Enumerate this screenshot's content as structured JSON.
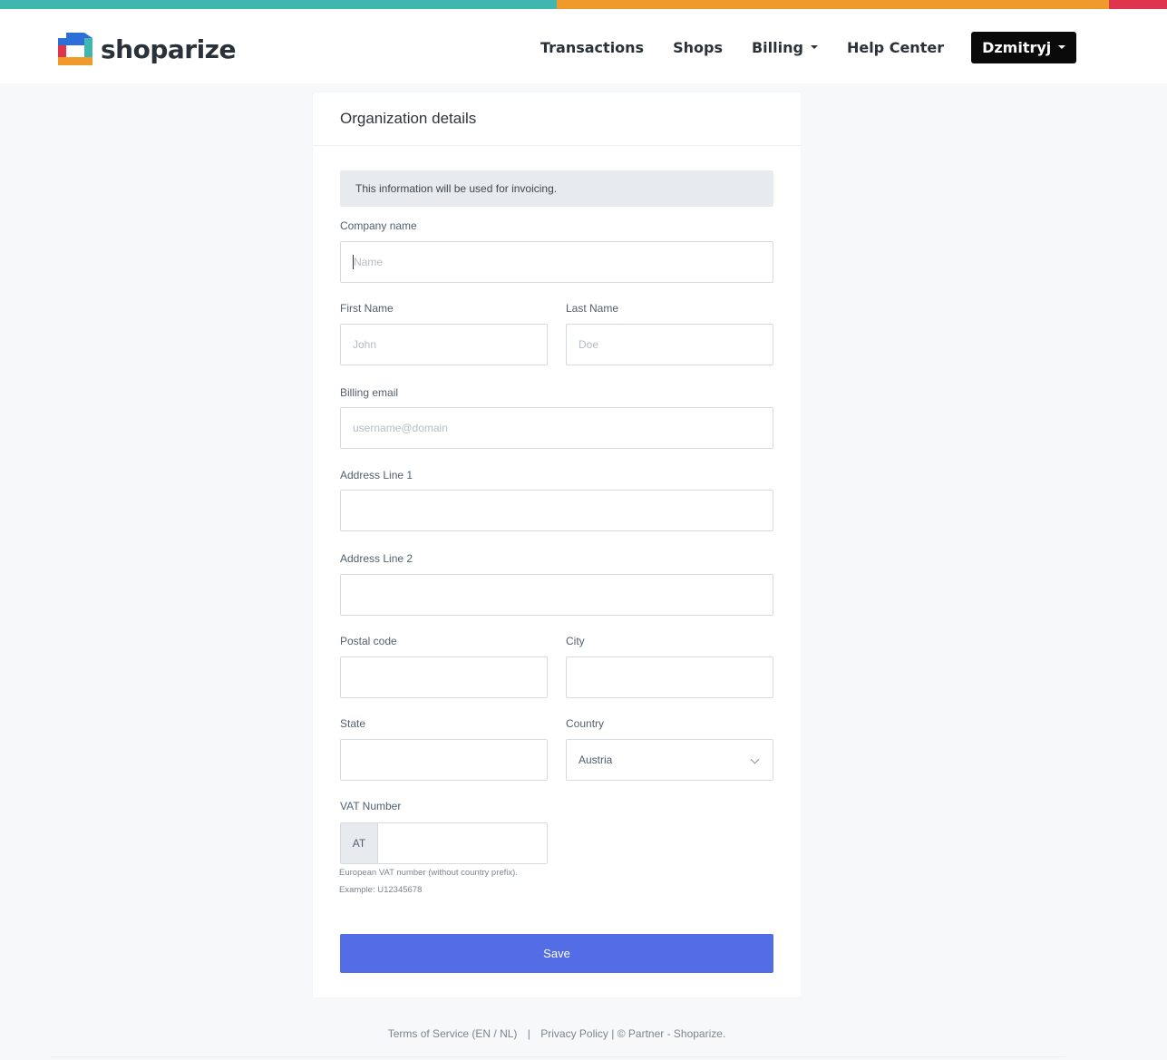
{
  "brand": {
    "name": "shoparize"
  },
  "nav": {
    "transactions": "Transactions",
    "shops": "Shops",
    "billing": "Billing",
    "help_center": "Help Center",
    "user": "Dzmitryj"
  },
  "card": {
    "title": "Organization details",
    "info": "This information will be used for invoicing."
  },
  "form": {
    "company_name": {
      "label": "Company name",
      "placeholder": "Name",
      "value": ""
    },
    "first_name": {
      "label": "First Name",
      "placeholder": "John",
      "value": ""
    },
    "last_name": {
      "label": "Last Name",
      "placeholder": "Doe",
      "value": ""
    },
    "billing_email": {
      "label": "Billing email",
      "placeholder": "username@domain",
      "value": ""
    },
    "address1": {
      "label": "Address Line 1",
      "value": ""
    },
    "address2": {
      "label": "Address Line 2",
      "value": ""
    },
    "postal_code": {
      "label": "Postal code",
      "value": ""
    },
    "city": {
      "label": "City",
      "value": ""
    },
    "state": {
      "label": "State",
      "value": ""
    },
    "country": {
      "label": "Country",
      "value": "Austria"
    },
    "vat": {
      "label": "VAT Number",
      "prefix": "AT",
      "value": "",
      "hint_line1": "European VAT number (without country prefix).",
      "hint_line2": "Example: U12345678"
    },
    "save": "Save"
  },
  "footer": {
    "terms": "Terms of Service (EN / NL)",
    "separator": "|",
    "privacy": "Privacy Policy",
    "copyright": "| © Partner - Shoparize."
  },
  "colors": {
    "stripe_teal": "#3fb6b0",
    "stripe_orange": "#ef9a2b",
    "stripe_red": "#e0334c",
    "primary": "#536de6"
  }
}
